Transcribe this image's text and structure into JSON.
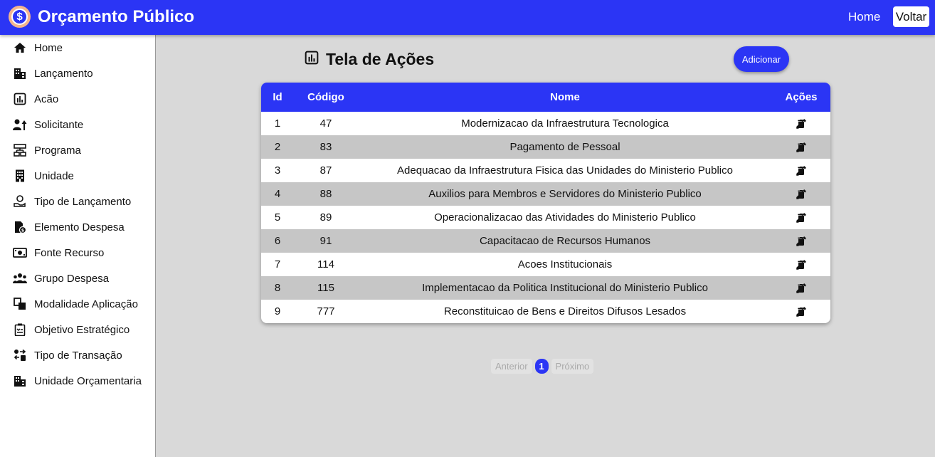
{
  "header": {
    "title": "Orçamento Público",
    "home": "Home",
    "back": "Voltar"
  },
  "sidebar": {
    "items": [
      {
        "label": "Home",
        "icon": "home-icon"
      },
      {
        "label": "Lançamento",
        "icon": "building-icon"
      },
      {
        "label": "Acão",
        "icon": "chart-icon"
      },
      {
        "label": "Solicitante",
        "icon": "person-arrow-icon"
      },
      {
        "label": "Programa",
        "icon": "program-icon"
      },
      {
        "label": "Unidade",
        "icon": "office-building-icon"
      },
      {
        "label": "Tipo de Lançamento",
        "icon": "hand-coin-icon"
      },
      {
        "label": "Elemento Despesa",
        "icon": "document-money-icon"
      },
      {
        "label": "Fonte Recurso",
        "icon": "banknote-icon"
      },
      {
        "label": "Grupo Despesa",
        "icon": "group-icon"
      },
      {
        "label": "Modalidade Aplicação",
        "icon": "modality-icon"
      },
      {
        "label": "Objetivo Estratégico",
        "icon": "clipboard-icon"
      },
      {
        "label": "Tipo de Transação",
        "icon": "transaction-icon"
      },
      {
        "label": "Unidade Orçamentaria",
        "icon": "building-icon"
      }
    ]
  },
  "main": {
    "title": "Tela de Ações",
    "add_label": "Adicionar",
    "columns": {
      "id": "Id",
      "code": "Código",
      "name": "Nome",
      "actions": "Ações"
    },
    "rows": [
      {
        "id": "1",
        "code": "47",
        "name": "Modernizacao da Infraestrutura Tecnologica"
      },
      {
        "id": "2",
        "code": "83",
        "name": "Pagamento de Pessoal"
      },
      {
        "id": "3",
        "code": "87",
        "name": "Adequacao da Infraestrutura Fisica das Unidades do Ministerio Publico"
      },
      {
        "id": "4",
        "code": "88",
        "name": "Auxilios para Membros e Servidores do Ministerio Publico"
      },
      {
        "id": "5",
        "code": "89",
        "name": "Operacionalizacao das Atividades do Ministerio Publico"
      },
      {
        "id": "6",
        "code": "91",
        "name": "Capacitacao de Recursos Humanos"
      },
      {
        "id": "7",
        "code": "114",
        "name": "Acoes Institucionais"
      },
      {
        "id": "8",
        "code": "115",
        "name": "Implementacao da Politica Institucional do Ministerio Publico"
      },
      {
        "id": "9",
        "code": "777",
        "name": "Reconstituicao de Bens e Direitos Difusos Lesados"
      }
    ],
    "pagination": {
      "prev": "Anterior",
      "current": "1",
      "next": "Próximo"
    }
  },
  "colors": {
    "accent": "#2b35f5",
    "row_alt": "#c6c6c6",
    "background": "#d9d9d9"
  }
}
